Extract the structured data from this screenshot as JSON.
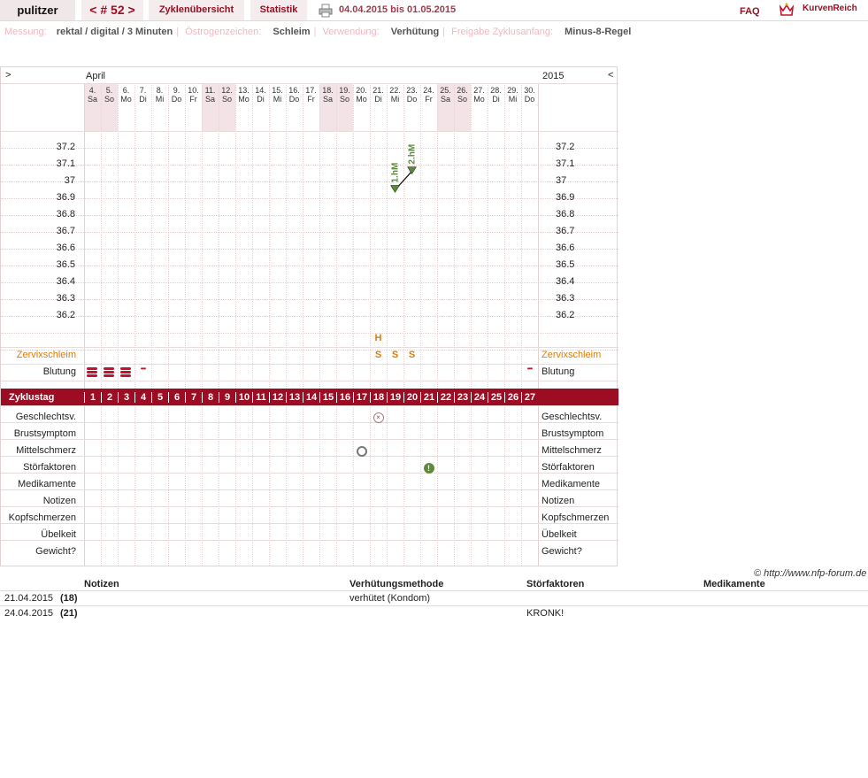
{
  "topbar": {
    "user": "pulitzer",
    "cycle_nav": "< # 52 >",
    "overview": "Zyklenübersicht",
    "stats": "Statistik",
    "date_range": "04.04.2015 bis 01.05.2015",
    "faq": "FAQ",
    "logo_text": "KurvenReich"
  },
  "meta": {
    "messung_label": "Messung:",
    "messung_value": "rektal / digital / 3 Minuten",
    "oestrogen_label": "Östrogenzeichen:",
    "oestrogen_value": "Schleim",
    "verwendung_label": "Verwendung:",
    "verwendung_value": "Verhütung",
    "freigabe_label": "Freigabe Zyklusanfang:",
    "freigabe_value": "Minus-8-Regel"
  },
  "chart": {
    "nav_prev": ">",
    "nav_next": "<",
    "month": "April",
    "year": "2015",
    "days": [
      {
        "d": "4.",
        "w": "Sa"
      },
      {
        "d": "5.",
        "w": "So"
      },
      {
        "d": "6.",
        "w": "Mo"
      },
      {
        "d": "7.",
        "w": "Di"
      },
      {
        "d": "8.",
        "w": "Mi"
      },
      {
        "d": "9.",
        "w": "Do"
      },
      {
        "d": "10.",
        "w": "Fr"
      },
      {
        "d": "11.",
        "w": "Sa"
      },
      {
        "d": "12.",
        "w": "So"
      },
      {
        "d": "13.",
        "w": "Mo"
      },
      {
        "d": "14.",
        "w": "Di"
      },
      {
        "d": "15.",
        "w": "Mi"
      },
      {
        "d": "16.",
        "w": "Do"
      },
      {
        "d": "17.",
        "w": "Fr"
      },
      {
        "d": "18.",
        "w": "Sa"
      },
      {
        "d": "19.",
        "w": "So"
      },
      {
        "d": "20.",
        "w": "Mo"
      },
      {
        "d": "21.",
        "w": "Di"
      },
      {
        "d": "22.",
        "w": "Mi"
      },
      {
        "d": "23.",
        "w": "Do"
      },
      {
        "d": "24.",
        "w": "Fr"
      },
      {
        "d": "25.",
        "w": "Sa"
      },
      {
        "d": "26.",
        "w": "So"
      },
      {
        "d": "27.",
        "w": "Mo"
      },
      {
        "d": "28.",
        "w": "Di"
      },
      {
        "d": "29.",
        "w": "Mi"
      },
      {
        "d": "30.",
        "w": "Do"
      }
    ],
    "temp_ticks": [
      "37.2",
      "37.1",
      "37",
      "36.9",
      "36.8",
      "36.7",
      "36.6",
      "36.5",
      "36.4",
      "36.3",
      "36.2"
    ],
    "temperatures": [
      {
        "cycle_day": 19,
        "value": 36.95
      },
      {
        "cycle_day": 20,
        "value": 37.06
      }
    ],
    "markers": {
      "first_hm": "1.hM",
      "second_hm": "2.hM"
    },
    "zervix_label": "Zervixschleim",
    "zervix_entries": [
      {
        "cycle_day": 18,
        "top": "H",
        "sym": "S"
      },
      {
        "cycle_day": 19,
        "sym": "S"
      },
      {
        "cycle_day": 20,
        "sym": "S"
      }
    ],
    "blutung_label": "Blutung",
    "zyklustag_label": "Zyklustag",
    "zyklustage": [
      "1",
      "2",
      "3",
      "4",
      "5",
      "6",
      "7",
      "8",
      "9",
      "10",
      "11",
      "12",
      "13",
      "14",
      "15",
      "16",
      "17",
      "18",
      "19",
      "20",
      "21",
      "22",
      "23",
      "24",
      "25",
      "26",
      "27"
    ],
    "rows": [
      "Geschlechtsv.",
      "Brustsymptom",
      "Mittelschmerz",
      "Störfaktoren",
      "Medikamente",
      "Notizen",
      "Kopfschmerzen",
      "Übelkeit",
      "Gewicht?"
    ],
    "colors": {
      "accent": "#9c0d23",
      "zervix": "#e07b0a",
      "marker": "#5c8a3a"
    }
  },
  "copyright": "© http://www.nfp-forum.de",
  "notes": {
    "headers": [
      "Notizen",
      "Verhütungsmethode",
      "Störfaktoren",
      "Medikamente"
    ],
    "rows": [
      {
        "date": "21.04.2015",
        "day": "(18)",
        "verhuetung": "verhütet (Kondom)",
        "stoer": ""
      },
      {
        "date": "24.04.2015",
        "day": "(21)",
        "verhuetung": "",
        "stoer": "KRONK!"
      }
    ]
  }
}
